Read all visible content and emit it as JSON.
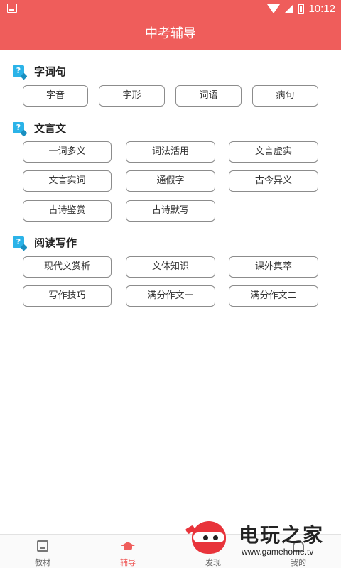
{
  "status_bar": {
    "time": "10:12"
  },
  "app_bar": {
    "title": "中考辅导"
  },
  "sections": [
    {
      "title": "字词句",
      "buttons": [
        "字音",
        "字形",
        "词语",
        "病句"
      ]
    },
    {
      "title": "文言文",
      "buttons": [
        "一词多义",
        "词法活用",
        "文言虚实",
        "文言实词",
        "通假字",
        "古今异义",
        "古诗鉴赏",
        "古诗默写"
      ]
    },
    {
      "title": "阅读写作",
      "buttons": [
        "现代文赏析",
        "文体知识",
        "课外集萃",
        "写作技巧",
        "满分作文一",
        "满分作文二"
      ]
    }
  ],
  "section_icon_glyph": "?",
  "bottom_nav": [
    {
      "label": "教材",
      "icon": "book-icon"
    },
    {
      "label": "辅导",
      "icon": "graduation-cap-icon",
      "active": true
    },
    {
      "label": "发现",
      "icon": "compass-icon"
    },
    {
      "label": "我的",
      "icon": "user-icon"
    }
  ],
  "watermark": {
    "title": "电玩之家",
    "url": "www.gamehome.tv"
  },
  "colors": {
    "accent": "#ef5d5b",
    "section_icon": "#2bb3e8",
    "button_border": "#8c8c8c"
  }
}
